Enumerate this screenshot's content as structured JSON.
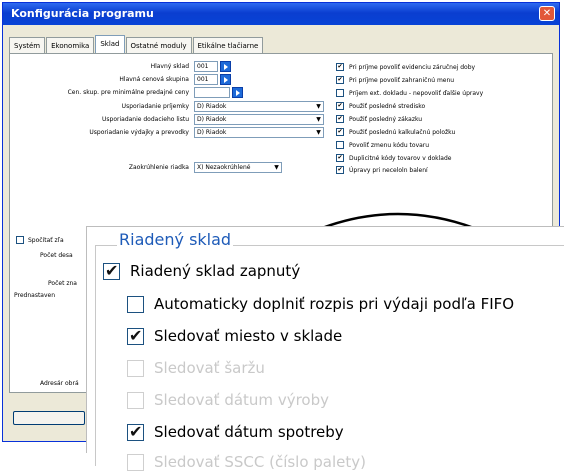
{
  "window": {
    "title": "Konfigurácia programu",
    "close_symbol": "✕"
  },
  "tabs": [
    {
      "label": "Systém"
    },
    {
      "label": "Ekonomika"
    },
    {
      "label": "Sklad"
    },
    {
      "label": "Ostatné moduly"
    },
    {
      "label": "Etikálne tlačiarne"
    }
  ],
  "form": {
    "hlavny_sklad": {
      "label": "Hlavný sklad",
      "value": "001"
    },
    "hlavna_cenova": {
      "label": "Hlavná cenová skupina",
      "value": "001"
    },
    "cen_skup": {
      "label": "Cen. skup. pre minimálne predajné ceny",
      "value": ""
    },
    "usp_prijemky": {
      "label": "Usporiadanie príjemky",
      "value": "D) Riadok"
    },
    "usp_dodacieho": {
      "label": "Usporiadanie dodacieho listu",
      "value": "D) Riadok"
    },
    "usp_vydajky": {
      "label": "Usporiadanie výdajky a prevodky",
      "value": "D) Riadok"
    },
    "zaokruhlenie": {
      "label": "Zaokrúhlenie riadka",
      "value": "X) Nezaokrúhlené"
    }
  },
  "right_checks": [
    {
      "label": "Pri príjme povoliť evidenciu záručnej doby",
      "checked": true
    },
    {
      "label": "Pri príjme povoliť zahraničnú menu",
      "checked": true
    },
    {
      "label": "Príjem ext. dokladu - nepovoliť ďalšie úpravy",
      "checked": false
    },
    {
      "label": "Použiť posledné stredisko",
      "checked": true
    },
    {
      "label": "Použiť posledný zákazku",
      "checked": true
    },
    {
      "label": "Použiť poslednú kalkulačnú položku",
      "checked": true
    },
    {
      "label": "Povoliť zmenu kódu tovaru",
      "checked": false
    },
    {
      "label": "Duplicitné kódy tovarov v doklade",
      "checked": true
    },
    {
      "label": "Úpravy pri neceloln balení",
      "checked": true
    }
  ],
  "left_partial": {
    "spocitat": "Spočítať zľa",
    "pocet_desa": "Počet desa",
    "pocet_zna": "Počet zna",
    "prednastaven": "Prednastaven",
    "adresar": "Adresár obrá"
  },
  "zoom": {
    "legend": "Riadený sklad",
    "items": [
      {
        "label": "Riadený sklad zapnutý",
        "checked": true,
        "disabled": false
      },
      {
        "label": "Automaticky doplniť rozpis pri výdaji podľa FIFO",
        "checked": false,
        "disabled": false
      },
      {
        "label": "Sledovať miesto v sklade",
        "checked": true,
        "disabled": false
      },
      {
        "label": "Sledovať šaržu",
        "checked": false,
        "disabled": true
      },
      {
        "label": "Sledovať dátum výroby",
        "checked": false,
        "disabled": true
      },
      {
        "label": "Sledovať dátum spotreby",
        "checked": true,
        "disabled": false
      },
      {
        "label": "Sledovať SSCC (číslo palety)",
        "checked": false,
        "disabled": true
      }
    ]
  }
}
